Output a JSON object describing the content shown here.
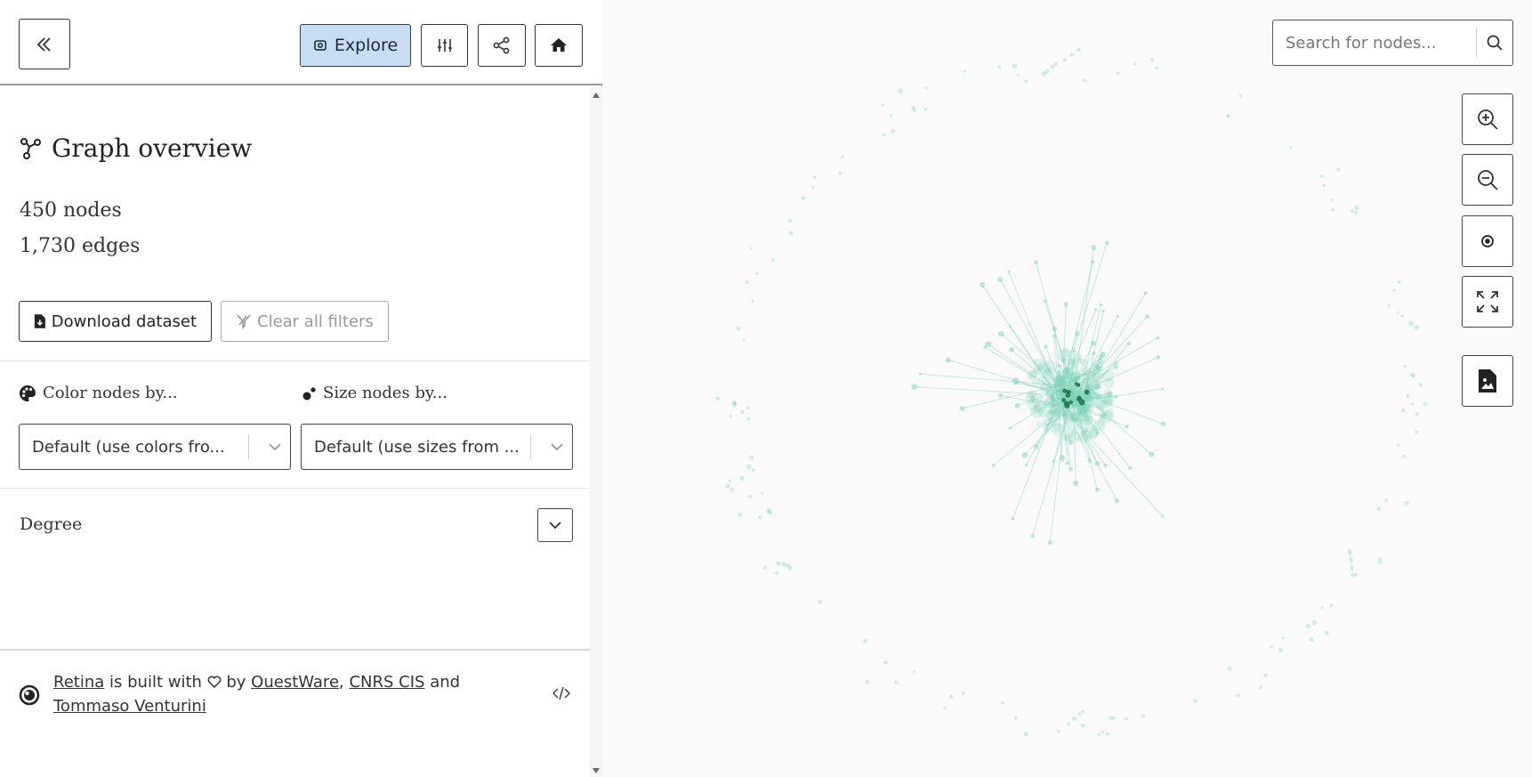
{
  "toolbar": {
    "collapse_icon": "chevrons-left-icon",
    "explore_label": "Explore",
    "settings_icon": "sliders-icon",
    "share_icon": "share-icon",
    "home_icon": "home-icon"
  },
  "overview": {
    "title": "Graph overview",
    "nodes_text": "450 nodes",
    "edges_text": "1,730 edges",
    "download_label": "Download dataset",
    "clear_label": "Clear all filters"
  },
  "appearance": {
    "color_label": "Color nodes by...",
    "color_value": "Default (use colors fro...",
    "size_label": "Size nodes by...",
    "size_value": "Default (use sizes from ..."
  },
  "filters": {
    "degree_label": "Degree"
  },
  "footer": {
    "retina": "Retina",
    "built_with": " is built with ",
    "by": " by ",
    "questware": "OuestWare",
    "comma": ", ",
    "cnrs": "CNRS CIS",
    "and": " and",
    "tommaso": "Tommaso Venturini"
  },
  "graph": {
    "search_placeholder": "Search for nodes...",
    "controls": [
      "zoom-in-icon",
      "zoom-out-icon",
      "center-icon",
      "fullscreen-icon",
      "export-image-icon"
    ],
    "node_color": "#7fd3bc",
    "hub_color": "#1f7a4d"
  },
  "colors": {
    "accent_button": "#c8dcf2",
    "border": "#333333"
  }
}
